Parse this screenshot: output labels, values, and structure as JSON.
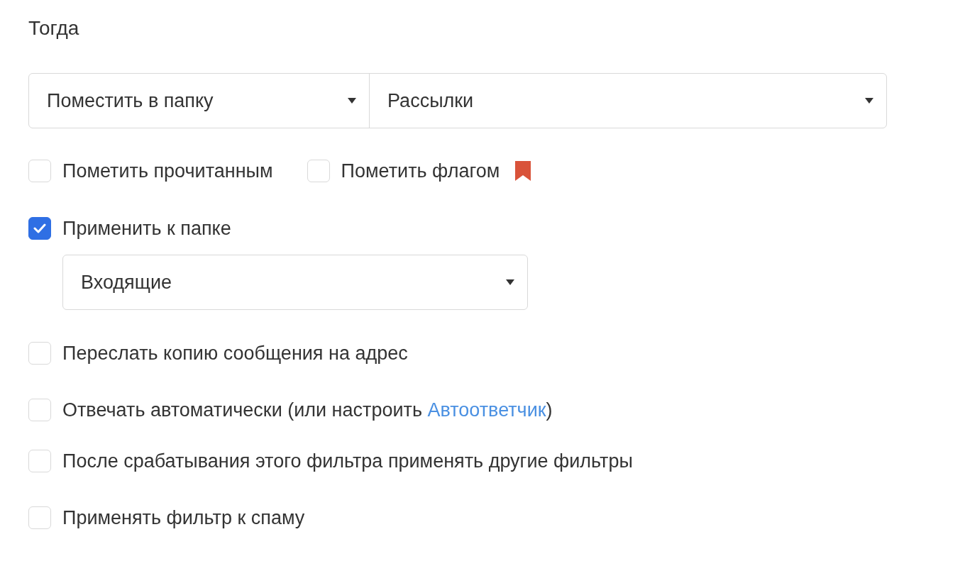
{
  "heading": "Тогда",
  "action": {
    "operation": {
      "value": "Поместить в папку"
    },
    "folder": {
      "value": "Рассылки"
    }
  },
  "rows": [
    {
      "kind": "pair",
      "checkboxes": [
        {
          "label": "Пометить прочитанным",
          "checked": false
        },
        {
          "label": "Пометить флагом",
          "checked": false
        }
      ]
    },
    {
      "kind": "checkbox",
      "label": "Применить к папке",
      "checked": true
    },
    {
      "kind": "select",
      "value": "Входящие"
    },
    {
      "kind": "checkbox",
      "label": "Переслать копию сообщения на адрес",
      "checked": false
    },
    {
      "kind": "link",
      "label": "Отвечать автоматически (или настроить ",
      "link": "Автоответчик",
      "after": ")",
      "checked": false
    },
    {
      "kind": "checkbox",
      "label": "После срабатывания этого фильтра применять другие фильтры",
      "checked": false
    },
    {
      "kind": "checkbox",
      "label": "Применять фильтр к спаму",
      "checked": false
    }
  ]
}
